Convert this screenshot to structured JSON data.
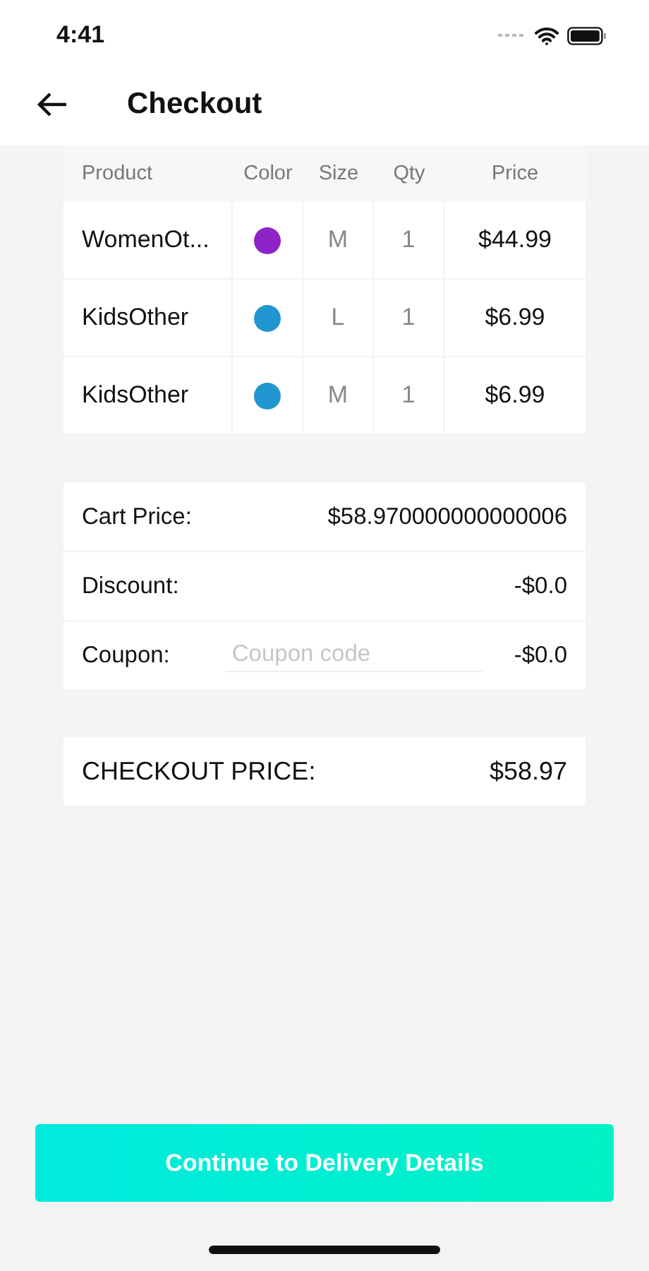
{
  "status_bar": {
    "time": "4:41"
  },
  "header": {
    "title": "Checkout"
  },
  "table": {
    "columns": [
      "Product",
      "Color",
      "Size",
      "Qty",
      "Price"
    ],
    "rows": [
      {
        "product": "WomenOt...",
        "color": "#8e24c8",
        "size": "M",
        "qty": "1",
        "price": "$44.99"
      },
      {
        "product": "KidsOther",
        "color": "#2196d0",
        "size": "L",
        "qty": "1",
        "price": "$6.99"
      },
      {
        "product": "KidsOther",
        "color": "#2196d0",
        "size": "M",
        "qty": "1",
        "price": "$6.99"
      }
    ]
  },
  "summary": [
    {
      "kind": "value",
      "label": "Cart Price:",
      "value": "$58.970000000000006"
    },
    {
      "kind": "value",
      "label": "Discount:",
      "value": "-$0.0"
    },
    {
      "kind": "coupon",
      "label": "Coupon:",
      "placeholder": "Coupon code",
      "value": "-$0.0"
    }
  ],
  "total": {
    "label": "CHECKOUT PRICE:",
    "value": "$58.97"
  },
  "continue_button": "Continue to Delivery Details"
}
